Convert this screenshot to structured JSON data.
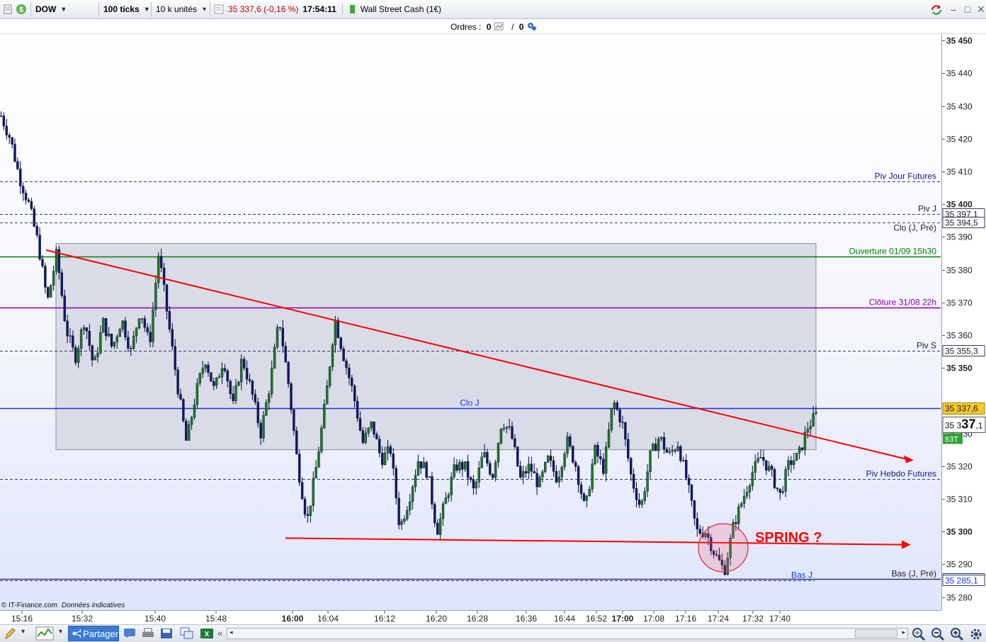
{
  "toolbar": {
    "instrument": "DOW",
    "ticks": "100 ticks",
    "units": "10 k unités",
    "quote": "35 337,6 (-0,16 %)",
    "time": "17:54:11",
    "market": "Wall Street Cash (1€)"
  },
  "orders": {
    "label": "Ordres :",
    "count_a": "0",
    "sep": "/",
    "count_b": "0"
  },
  "footer": {
    "copyright": "© IT-Finance.com",
    "disclaimer": "Données indicatives",
    "share": "Partager"
  },
  "colors": {
    "up": "#1e7a1e",
    "down": "#121860",
    "red": "#ff0000",
    "blue": "#1a35e6",
    "green": "#008000",
    "purple": "#8b00a8",
    "zone": "#d6d9e4"
  },
  "chart_data": {
    "type": "candlestick",
    "ylim": [
      35276,
      35452
    ],
    "y_ticks": [
      35450,
      35440,
      35430,
      35420,
      35410,
      35400,
      35390,
      35380,
      35370,
      35360,
      35350,
      35330,
      35320,
      35310,
      35300,
      35290,
      35280
    ],
    "x_ticks": [
      {
        "label": "15:16",
        "bold": false
      },
      {
        "label": "15:32",
        "bold": false
      },
      {
        "label": "15:40",
        "bold": false
      },
      {
        "label": "15:48",
        "bold": false
      },
      {
        "label": "16:00",
        "bold": true
      },
      {
        "label": "16:04",
        "bold": false
      },
      {
        "label": "16:12",
        "bold": false
      },
      {
        "label": "16:20",
        "bold": false
      },
      {
        "label": "16:28",
        "bold": false
      },
      {
        "label": "16:36",
        "bold": false
      },
      {
        "label": "16:44",
        "bold": false
      },
      {
        "label": "16:52",
        "bold": false
      },
      {
        "label": "17:00",
        "bold": true
      },
      {
        "label": "17:08",
        "bold": false
      },
      {
        "label": "17:16",
        "bold": false
      },
      {
        "label": "17:24",
        "bold": false
      },
      {
        "label": "17:32",
        "bold": false
      },
      {
        "label": "17:40",
        "bold": false
      }
    ],
    "price_path": [
      35427,
      35420,
      35408,
      35400,
      35388,
      35370,
      35385,
      35362,
      35353,
      35365,
      35350,
      35364,
      35356,
      35365,
      35355,
      35368,
      35357,
      35385,
      35365,
      35345,
      35327,
      35342,
      35353,
      35343,
      35353,
      35338,
      35353,
      35343,
      35330,
      35345,
      35365,
      35345,
      35320,
      35303,
      35320,
      35340,
      35365,
      35353,
      35342,
      35327,
      35333,
      35322,
      35325,
      35301,
      35310,
      35322,
      35318,
      35300,
      35310,
      35320,
      35320,
      35312,
      35324,
      35317,
      35334,
      35330,
      35316,
      35320,
      35314,
      35322,
      35316,
      35328,
      35320,
      35306,
      35325,
      35319,
      35340,
      35333,
      35316,
      35307,
      35323,
      35329,
      35323,
      35327,
      35315,
      35300,
      35300,
      35293,
      35288,
      35302,
      35310,
      35318,
      35323,
      35318,
      35311,
      35321,
      35323,
      35332,
      35336
    ],
    "horizontal_lines": [
      {
        "label": "Piv Jour Futures",
        "value": 35407,
        "style": "dashed",
        "color": "#333a66",
        "label_color": "#1a1a8a",
        "tag": ""
      },
      {
        "label": "Piv J",
        "value": 35397.1,
        "style": "dashed",
        "color": "#333a66",
        "label_color": "#222222",
        "tag": "35 397,1"
      },
      {
        "label": "Clo (J, Pré)",
        "value": 35394.5,
        "style": "dashed",
        "color": "#333a66",
        "label_color": "#222222",
        "tag": "35 394,5"
      },
      {
        "label": "Ouverture 01/09 15h30",
        "value": 35384,
        "style": "solid",
        "color": "#008000",
        "label_color": "#008000",
        "tag": ""
      },
      {
        "label": "Clôture 31/08 22h",
        "value": 35368.5,
        "style": "solid",
        "color": "#8b00a8",
        "label_color": "#8b00a8",
        "tag": ""
      },
      {
        "label": "Piv S",
        "value": 35355.3,
        "style": "dashed",
        "color": "#333a66",
        "label_color": "#222222",
        "tag": "35 355,3"
      },
      {
        "label": "Piv Hebdo Futures",
        "value": 35316,
        "style": "dashed",
        "color": "#333a66",
        "label_color": "#1a1a8a",
        "tag": ""
      },
      {
        "label": "Bas (J, Pré)",
        "value": 35285.6,
        "style": "solid",
        "color": "#333a66",
        "label_color": "#222222",
        "tag": "35 285,6"
      },
      {
        "label": "Bas J",
        "value": 35285.1,
        "style": "dashed",
        "color": "#1a35e6",
        "label_color": "#1a35e6",
        "tag": "35 285,1"
      }
    ],
    "clo_line": {
      "label": "Clo J",
      "value": 35337.6,
      "tag": "35 337,6"
    },
    "last_price": {
      "prefix": "35 3",
      "big": "37",
      "suffix": ",1",
      "volume": "83T"
    },
    "trading_range": {
      "high": 35388,
      "low": 35325
    },
    "trendline_down": {
      "from": 35386,
      "to": 35322
    },
    "support_line": {
      "from": 35298,
      "to": 35296
    },
    "spring_label": "SPRING ?"
  }
}
